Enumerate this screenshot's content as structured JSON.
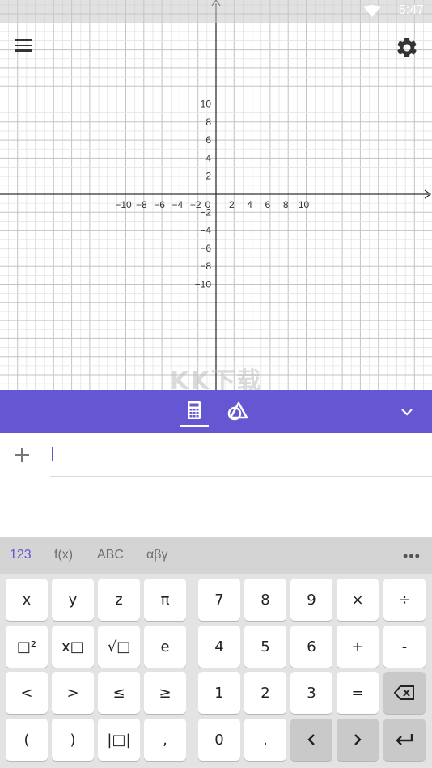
{
  "status": {
    "time": "5:47"
  },
  "graph": {
    "x_labels": [
      "−10",
      "−8",
      "−6",
      "−4",
      "−2",
      "0",
      "2",
      "4",
      "6",
      "8",
      "10"
    ],
    "y_labels": [
      "10",
      "8",
      "6",
      "4",
      "2",
      "−2",
      "−4",
      "−6",
      "−8",
      "−10"
    ]
  },
  "watermark": "KK下载",
  "algebra": {
    "input_value": ""
  },
  "keyboard": {
    "tabs": [
      "123",
      "f(x)",
      "ABC",
      "αβγ"
    ],
    "more": "•••",
    "left_rows": [
      [
        "x",
        "y",
        "z",
        "π"
      ],
      [
        "□²",
        "x□",
        "√□",
        "e"
      ],
      [
        "<",
        ">",
        "≤",
        "≥"
      ],
      [
        "(",
        ")",
        "|□|",
        ","
      ]
    ],
    "right_rows": [
      [
        "7",
        "8",
        "9",
        "×",
        "÷"
      ],
      [
        "4",
        "5",
        "6",
        "+",
        "-"
      ],
      [
        "1",
        "2",
        "3",
        "=",
        "⌫"
      ],
      [
        "0",
        ".",
        "<",
        ">",
        "↵"
      ]
    ]
  }
}
